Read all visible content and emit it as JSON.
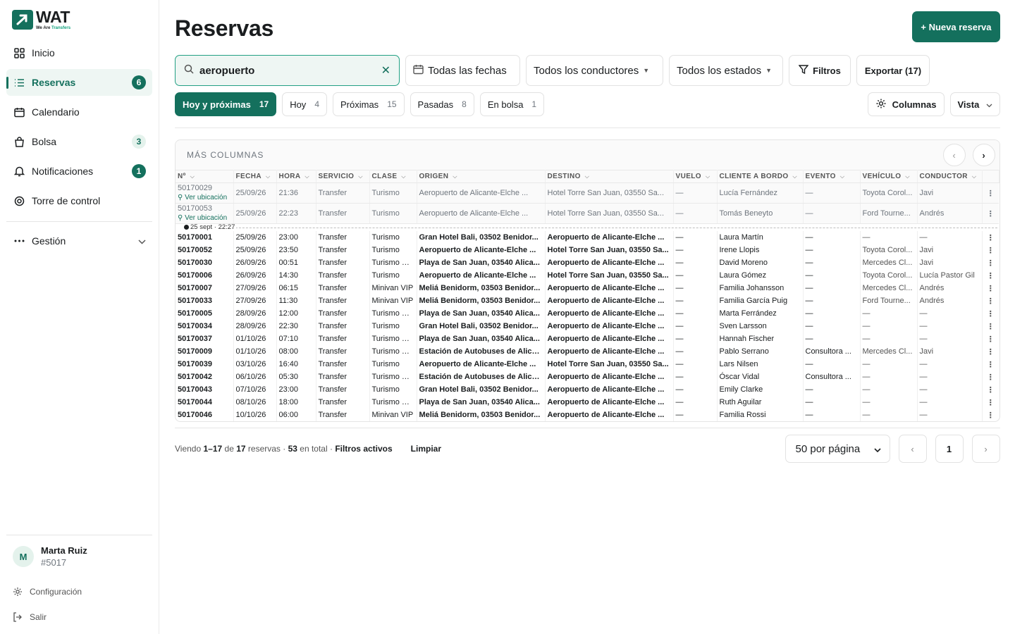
{
  "brand": {
    "name": "WAT",
    "sub_a": "We Are",
    "sub_b": "Transfers"
  },
  "sidebar": {
    "items": [
      {
        "label": "Inicio",
        "icon": "grid-icon"
      },
      {
        "label": "Reservas",
        "icon": "list-icon",
        "badge": "6"
      },
      {
        "label": "Calendario",
        "icon": "calendar-icon"
      },
      {
        "label": "Bolsa",
        "icon": "bag-icon",
        "badge": "3"
      },
      {
        "label": "Notificaciones",
        "icon": "bell-icon",
        "badge": "1"
      },
      {
        "label": "Torre de control",
        "icon": "target-icon"
      }
    ],
    "group": {
      "label": "Gestión"
    },
    "user": {
      "initial": "M",
      "name": "Marta Ruiz",
      "id": "#5017"
    },
    "settings": "Configuración",
    "logout": "Salir"
  },
  "header": {
    "title": "Reservas",
    "new_button": "+ Nueva reserva"
  },
  "filters": {
    "search_value": "aeropuerto",
    "dates": "Todas las fechas",
    "drivers": "Todos los conductores",
    "states": "Todos los estados",
    "filters": "Filtros",
    "export": "Exportar (17)"
  },
  "tabs": [
    {
      "label": "Hoy y próximas",
      "count": "17"
    },
    {
      "label": "Hoy",
      "count": "4"
    },
    {
      "label": "Próximas",
      "count": "15"
    },
    {
      "label": "Pasadas",
      "count": "8"
    },
    {
      "label": "En bolsa",
      "count": "1"
    }
  ],
  "columns_button": "Columnas",
  "view_button": "Vista",
  "table": {
    "more_columns": "MÁS COLUMNAS",
    "headers": [
      "Nº",
      "FECHA",
      "HORA",
      "SERVICIO",
      "CLASE",
      "ORIGEN",
      "DESTINO",
      "VUELO",
      "CLIENTE A BORDO",
      "EVENTO",
      "VEHÍCULO",
      "CONDUCTOR"
    ],
    "location_link": "Ver ubicación",
    "separator": "25 sept · 22:27",
    "past_rows": [
      [
        "50170029",
        "25/09/26",
        "21:36",
        "Transfer",
        "Turismo",
        "Aeropuerto de Alicante-Elche ...",
        "Hotel Torre San Juan, 03550 Sa...",
        "—",
        "Lucía Fernández",
        "—",
        "Toyota Corol...",
        "Javi"
      ],
      [
        "50170053",
        "25/09/26",
        "22:23",
        "Transfer",
        "Turismo",
        "Aeropuerto de Alicante-Elche ...",
        "Hotel Torre San Juan, 03550 Sa...",
        "—",
        "Tomás Beneyto",
        "—",
        "Ford Tourne...",
        "Andrés"
      ]
    ],
    "rows": [
      [
        "50170001",
        "25/09/26",
        "23:00",
        "Transfer",
        "Turismo",
        "Gran Hotel Bali, 03502 Benidor...",
        "Aeropuerto de Alicante-Elche ...",
        "—",
        "Laura Martín",
        "—",
        "—",
        "—"
      ],
      [
        "50170052",
        "25/09/26",
        "23:50",
        "Transfer",
        "Turismo",
        "Aeropuerto de Alicante-Elche ...",
        "Hotel Torre San Juan, 03550 Sa...",
        "—",
        "Irene Llopis",
        "—",
        "Toyota Corol...",
        "Javi"
      ],
      [
        "50170030",
        "26/09/26",
        "00:51",
        "Transfer",
        "Turismo VIP",
        "Playa de San Juan, 03540 Alica...",
        "Aeropuerto de Alicante-Elche ...",
        "—",
        "David Moreno",
        "—",
        "Mercedes Cl...",
        "Javi"
      ],
      [
        "50170006",
        "26/09/26",
        "14:30",
        "Transfer",
        "Turismo",
        "Aeropuerto de Alicante-Elche ...",
        "Hotel Torre San Juan, 03550 Sa...",
        "—",
        "Laura Gómez",
        "—",
        "Toyota Corol...",
        "Lucía Pastor Gil"
      ],
      [
        "50170007",
        "27/09/26",
        "06:15",
        "Transfer",
        "Minivan VIP",
        "Meliá Benidorm, 03503 Benidor...",
        "Aeropuerto de Alicante-Elche ...",
        "—",
        "Familia Johansson",
        "—",
        "Mercedes Cl...",
        "Andrés"
      ],
      [
        "50170033",
        "27/09/26",
        "11:30",
        "Transfer",
        "Minivan VIP",
        "Meliá Benidorm, 03503 Benidor...",
        "Aeropuerto de Alicante-Elche ...",
        "—",
        "Familia García Puig",
        "—",
        "Ford Tourne...",
        "Andrés"
      ],
      [
        "50170005",
        "28/09/26",
        "12:00",
        "Transfer",
        "Turismo VIP",
        "Playa de San Juan, 03540 Alica...",
        "Aeropuerto de Alicante-Elche ...",
        "—",
        "Marta Ferrández",
        "—",
        "—",
        "—"
      ],
      [
        "50170034",
        "28/09/26",
        "22:30",
        "Transfer",
        "Turismo",
        "Gran Hotel Bali, 03502 Benidor...",
        "Aeropuerto de Alicante-Elche ...",
        "—",
        "Sven Larsson",
        "—",
        "—",
        "—"
      ],
      [
        "50170037",
        "01/10/26",
        "07:10",
        "Transfer",
        "Turismo VIP",
        "Playa de San Juan, 03540 Alica...",
        "Aeropuerto de Alicante-Elche ...",
        "—",
        "Hannah Fischer",
        "—",
        "—",
        "—"
      ],
      [
        "50170009",
        "01/10/26",
        "08:00",
        "Transfer",
        "Turismo VIP",
        "Estación de Autobuses de Alica...",
        "Aeropuerto de Alicante-Elche ...",
        "—",
        "Pablo Serrano",
        "Consultora ...",
        "Mercedes Cl...",
        "Javi"
      ],
      [
        "50170039",
        "03/10/26",
        "16:40",
        "Transfer",
        "Turismo",
        "Aeropuerto de Alicante-Elche ...",
        "Hotel Torre San Juan, 03550 Sa...",
        "—",
        "Lars Nilsen",
        "—",
        "—",
        "—"
      ],
      [
        "50170042",
        "06/10/26",
        "05:30",
        "Transfer",
        "Turismo VIP",
        "Estación de Autobuses de Alica...",
        "Aeropuerto de Alicante-Elche ...",
        "—",
        "Óscar Vidal",
        "Consultora ...",
        "—",
        "—"
      ],
      [
        "50170043",
        "07/10/26",
        "23:00",
        "Transfer",
        "Turismo",
        "Gran Hotel Bali, 03502 Benidor...",
        "Aeropuerto de Alicante-Elche ...",
        "—",
        "Emily Clarke",
        "—",
        "—",
        "—"
      ],
      [
        "50170044",
        "08/10/26",
        "18:00",
        "Transfer",
        "Turismo VIP",
        "Playa de San Juan, 03540 Alica...",
        "Aeropuerto de Alicante-Elche ...",
        "—",
        "Ruth Aguilar",
        "—",
        "—",
        "—"
      ],
      [
        "50170046",
        "10/10/26",
        "06:00",
        "Transfer",
        "Minivan VIP",
        "Meliá Benidorm, 03503 Benidor...",
        "Aeropuerto de Alicante-Elche ...",
        "—",
        "Familia Rossi",
        "—",
        "—",
        "—"
      ]
    ]
  },
  "footer": {
    "info_a": "Viendo ",
    "range": "1–17",
    "info_b": " de ",
    "count": "17",
    "info_c": " reservas · ",
    "total": "53",
    "info_d": " en total · ",
    "active": "Filtros activos",
    "clear": "Limpiar",
    "per_page": "50 por página",
    "page": "1"
  },
  "colors": {
    "accent": "#14705d",
    "accent_light": "#eef6f3"
  }
}
